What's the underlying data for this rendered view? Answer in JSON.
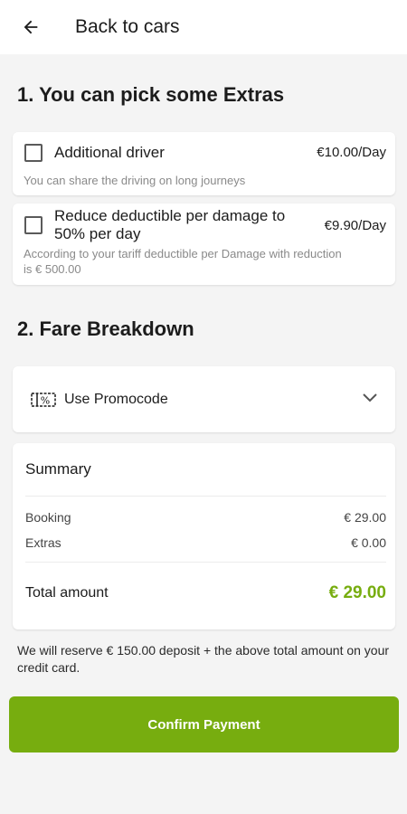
{
  "header": {
    "title": "Back to cars",
    "back_icon": "arrow-left-icon"
  },
  "extras": {
    "section_title": "1. You can pick some Extras",
    "items": [
      {
        "title": "Additional driver",
        "price": "€10.00/Day",
        "description": "You can share the driving on long journeys",
        "checked": false
      },
      {
        "title": "Reduce deductible per damage to 50% per day",
        "price": "€9.90/Day",
        "description": "According to your tariff deductible per Damage with reduction is € 500.00",
        "checked": false
      }
    ]
  },
  "fare": {
    "section_title": "2. Fare Breakdown",
    "promo": {
      "label": "Use Promocode",
      "icon": "percent-ticket-icon",
      "chevron_icon": "chevron-down-icon"
    },
    "summary": {
      "title": "Summary",
      "rows": [
        {
          "label": "Booking",
          "value": "€ 29.00"
        },
        {
          "label": "Extras",
          "value": "€ 0.00"
        }
      ],
      "total_label": "Total amount",
      "total_value": "€ 29.00"
    }
  },
  "deposit_note": "We will reserve € 150.00 deposit + the above total amount on your credit card.",
  "confirm_button": {
    "label": "Confirm Payment"
  },
  "colors": {
    "accent": "#77ad0f",
    "page_bg": "#f4f4f4",
    "card_bg": "#ffffff",
    "muted_text": "#8a8a8a"
  }
}
